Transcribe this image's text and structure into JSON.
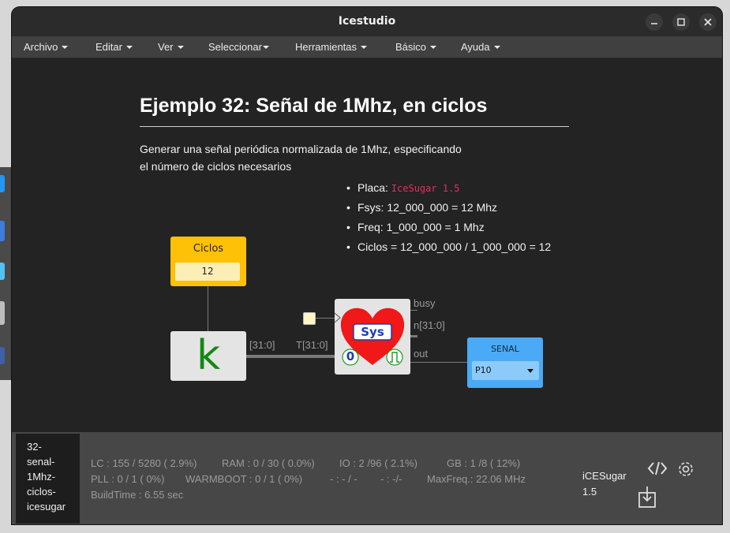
{
  "window": {
    "title": "Icestudio",
    "controls": [
      "minimize-icon",
      "maximize-icon",
      "close-icon"
    ]
  },
  "menu": [
    {
      "label": "Archivo"
    },
    {
      "label": "Editar"
    },
    {
      "label": "Ver"
    },
    {
      "label": "Seleccionar"
    },
    {
      "label": "Herramientas"
    },
    {
      "label": "Básico"
    },
    {
      "label": "Ayuda"
    }
  ],
  "doc": {
    "heading": "Ejemplo 32: Señal de 1Mhz, en ciclos",
    "desc_line1": "Generar una señal periódica normalizada de 1Mhz, especificando",
    "desc_line2": "el número de ciclos necesarios",
    "bullets": {
      "placa_label": "Placa:",
      "placa_value": "IceSugar 1.5",
      "fsys": "Fsys: 12_000_000 = 12 Mhz",
      "freq": "Freq: 1_000_000 = 1 Mhz",
      "ciclos": "Ciclos = 12_000_000 / 1_000_000 = 12"
    }
  },
  "circuit": {
    "ciclos_block": {
      "label": "Ciclos",
      "value": "12"
    },
    "k_block": {
      "symbol": "k"
    },
    "sys_block": {
      "label": "Sys",
      "left_port": "0"
    },
    "wire_labels": {
      "k_out": "[31:0]",
      "sys_in": "T[31:0]"
    },
    "sys_ports": {
      "busy": "busy",
      "n": "n[31:0]",
      "out": "out"
    },
    "senal_block": {
      "label": "SENAL",
      "pin": "P10"
    }
  },
  "footer": {
    "project_name": "32-\nsenal-\n1Mhz-\nciclos-\nicesugar",
    "stats": {
      "lc": "LC : 155 / 5280 ( 2.9%)",
      "ram": "RAM : 0 / 30 ( 0.0%)",
      "io": "IO :  2 /96  ( 2.1%)",
      "gb": "GB :  1 /8  ( 12%)",
      "pll": "PLL : 0 / 1 ( 0%)",
      "warmboot": "WARMBOOT : 0 / 1 ( 0%)",
      "blank1": "- : - / -",
      "blank2": "- :  -/-",
      "maxfreq": "MaxFreq.:  22.06 MHz",
      "buildtime": "BuildTime :    6.55 sec"
    },
    "board": "iCESugar\n1.5",
    "icons": [
      "code-icon",
      "settings-gear-icon",
      "download-icon"
    ]
  }
}
